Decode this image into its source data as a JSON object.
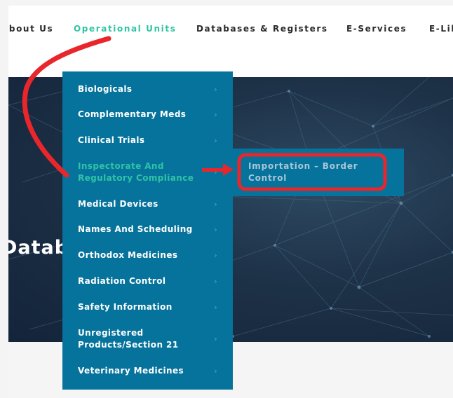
{
  "nav": {
    "items": [
      {
        "label": "About Us"
      },
      {
        "label": "Operational Units"
      },
      {
        "label": "Databases & Registers"
      },
      {
        "label": "E-Services"
      },
      {
        "label": "E-Library"
      }
    ]
  },
  "hero": {
    "title": "Databases"
  },
  "dropdown": {
    "items": [
      {
        "label": "Biologicals"
      },
      {
        "label": "Complementary Meds"
      },
      {
        "label": "Clinical Trials"
      },
      {
        "label": "Inspectorate And Regulatory Compliance"
      },
      {
        "label": "Medical Devices"
      },
      {
        "label": "Names And Scheduling"
      },
      {
        "label": "Orthodox Medicines"
      },
      {
        "label": "Radiation Control"
      },
      {
        "label": "Safety Information"
      },
      {
        "label": "Unregistered Products/Section 21"
      },
      {
        "label": "Veterinary Medicines"
      }
    ],
    "chevron": "›"
  },
  "submenu": {
    "items": [
      {
        "label": "Importation – Border Control"
      }
    ]
  },
  "colors": {
    "accent": "#2ec4a5",
    "menu_bg": "#06739c",
    "annotation": "#e8262b",
    "hero_bg": "#1d3147"
  }
}
